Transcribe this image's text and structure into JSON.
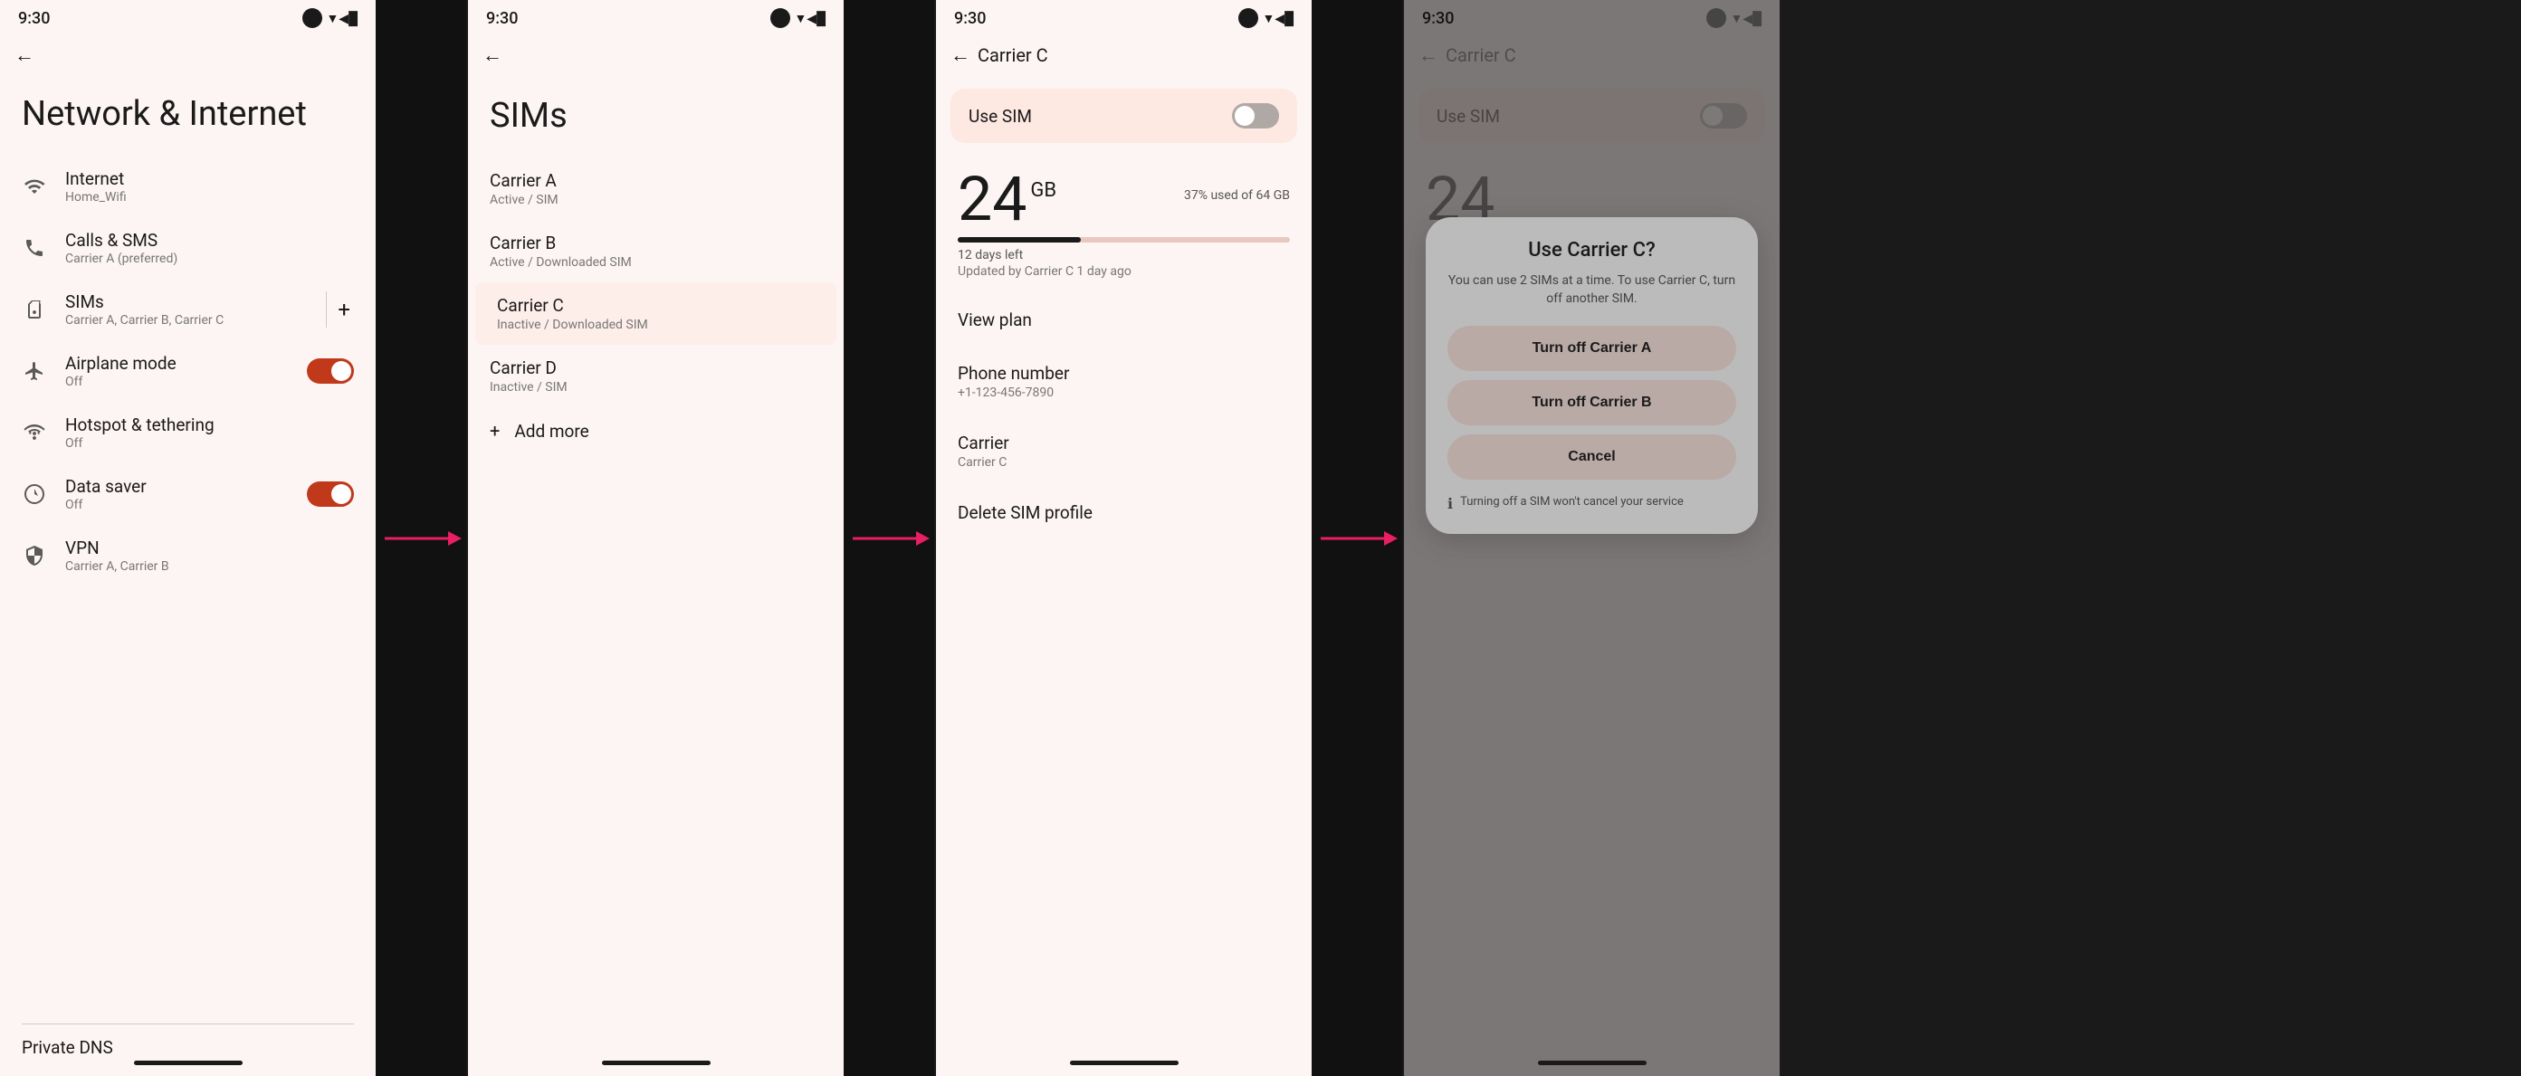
{
  "screens": {
    "screen1": {
      "time": "9:30",
      "title": "Network & Internet",
      "items": [
        {
          "icon": "wifi",
          "label": "Internet",
          "sub": "Home_Wifi"
        },
        {
          "icon": "phone",
          "label": "Calls & SMS",
          "sub": "Carrier A (preferred)"
        },
        {
          "icon": "sim",
          "label": "SIMs",
          "sub": "Carrier A, Carrier B, Carrier C",
          "has_add": true
        },
        {
          "icon": "airplane",
          "label": "Airplane mode",
          "sub": "Off",
          "has_toggle": true,
          "toggle_on": true
        },
        {
          "icon": "hotspot",
          "label": "Hotspot & tethering",
          "sub": "Off"
        },
        {
          "icon": "datasaver",
          "label": "Data saver",
          "sub": "Off",
          "has_toggle": true,
          "toggle_on": true
        },
        {
          "icon": "vpn",
          "label": "VPN",
          "sub": "Carrier A, Carrier B"
        }
      ],
      "private_dns": "Private DNS"
    },
    "screen2": {
      "time": "9:30",
      "title": "SIMs",
      "items": [
        {
          "name": "Carrier A",
          "status": "Active / SIM"
        },
        {
          "name": "Carrier B",
          "status": "Active / Downloaded SIM"
        },
        {
          "name": "Carrier C",
          "status": "Inactive / Downloaded SIM",
          "highlighted": true
        },
        {
          "name": "Carrier D",
          "status": "Inactive / SIM"
        }
      ],
      "add_more": "Add more"
    },
    "screen3": {
      "time": "9:30",
      "title": "Carrier C",
      "use_sim_label": "Use SIM",
      "data_amount": "24",
      "data_unit": "GB",
      "data_used_pct": "37% used of 64 GB",
      "data_bar_fill": 37,
      "days_left": "12 days left",
      "updated": "Updated by Carrier C 1 day ago",
      "menu_items": [
        {
          "label": "View plan"
        },
        {
          "label": "Phone number",
          "sub": "+1-123-456-7890"
        },
        {
          "label": "Carrier",
          "sub": "Carrier C"
        },
        {
          "label": "Delete SIM profile"
        }
      ]
    },
    "screen4": {
      "time": "9:30",
      "title": "Carrier C",
      "use_sim_label": "Use SIM",
      "data_partial": "24",
      "dialog": {
        "title": "Use Carrier C?",
        "description": "You can use 2 SIMs at a time. To use Carrier C, turn off another SIM.",
        "btn1": "Turn off Carrier A",
        "btn2": "Turn off Carrier B",
        "btn_cancel": "Cancel",
        "info": "Turning off a SIM won't cancel your service"
      }
    }
  },
  "arrow": "→"
}
